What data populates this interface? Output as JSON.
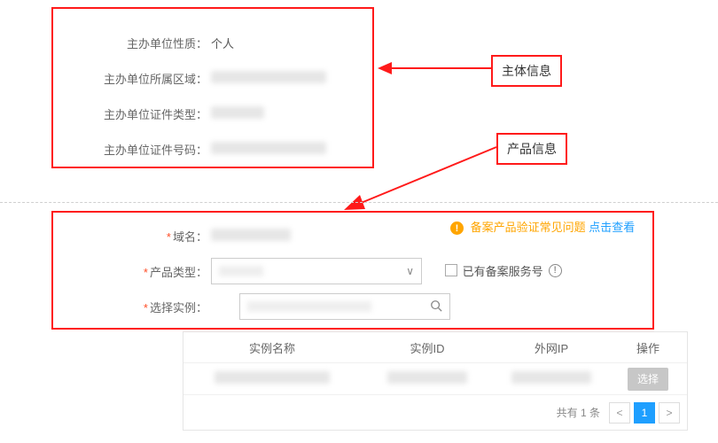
{
  "subject": {
    "nature_label": "主办单位性质：",
    "nature_value": "个人",
    "region_label": "主办单位所属区域：",
    "doctype_label": "主办单位证件类型：",
    "docnum_label": "主办单位证件号码："
  },
  "tags": {
    "subject": "主体信息",
    "product": "产品信息"
  },
  "product": {
    "domain_label": "域名：",
    "type_label": "产品类型：",
    "instance_label": "选择实例：",
    "help_orange": "备案产品验证常见问题",
    "help_link": "点击查看",
    "checkbox_label": "已有备案服务号"
  },
  "table": {
    "headers": {
      "name": "实例名称",
      "id": "实例ID",
      "ip": "外网IP",
      "op": "操作"
    },
    "select_btn": "选择",
    "pager_text": "共有 1 条",
    "page": "1"
  }
}
